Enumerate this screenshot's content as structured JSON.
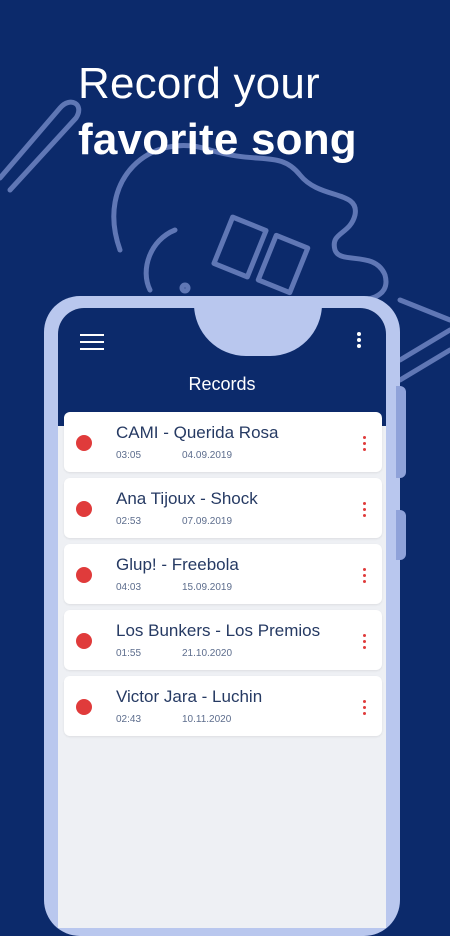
{
  "headline": {
    "line1": "Record your",
    "line2": "favorite song"
  },
  "app_title": "Records",
  "records": [
    {
      "title": "CAMI - Querida Rosa",
      "duration": "03:05",
      "date": "04.09.2019"
    },
    {
      "title": "Ana Tijoux - Shock",
      "duration": "02:53",
      "date": "07.09.2019"
    },
    {
      "title": "Glup! - Freebola",
      "duration": "04:03",
      "date": "15.09.2019"
    },
    {
      "title": "Los Bunkers - Los Premios",
      "duration": "01:55",
      "date": "21.10.2020"
    },
    {
      "title": "Victor Jara - Luchin",
      "duration": "02:43",
      "date": "10.11.2020"
    }
  ],
  "icons": {
    "menu": "hamburger-menu-icon",
    "more": "vertical-dots-icon",
    "record": "record-dot-icon",
    "art": "guitar-illustration"
  },
  "colors": {
    "background": "#0c2a6b",
    "phone_frame": "#b9c7ee",
    "record": "#e03b3b",
    "list_bg": "#eef0f4"
  }
}
